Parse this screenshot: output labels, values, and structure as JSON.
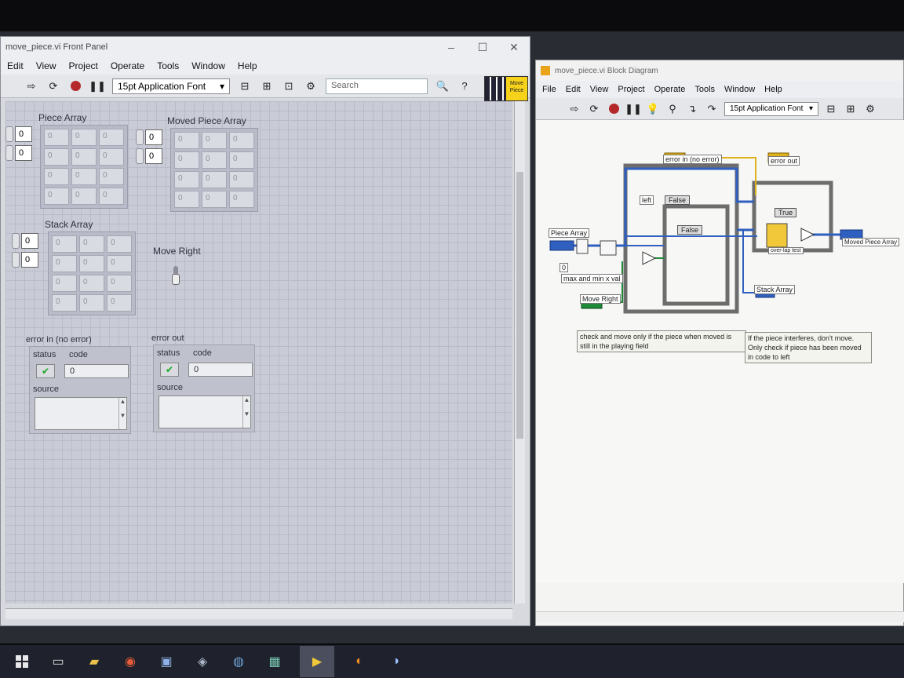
{
  "front_panel": {
    "title": "move_piece.vi Front Panel",
    "menu": [
      "Edit",
      "View",
      "Project",
      "Operate",
      "Tools",
      "Window",
      "Help"
    ],
    "font": "15pt Application Font",
    "search_placeholder": "Search",
    "vi_icon_text": "Move Piece",
    "piece_array": {
      "label": "Piece Array",
      "index": [
        "0",
        "0"
      ],
      "cells": [
        "0",
        "0",
        "0",
        "0",
        "0",
        "0",
        "0",
        "0",
        "0",
        "0",
        "0",
        "0"
      ]
    },
    "moved_piece_array": {
      "label": "Moved Piece Array",
      "index": [
        "0",
        "0"
      ],
      "cells": [
        "0",
        "0",
        "0",
        "0",
        "0",
        "0",
        "0",
        "0",
        "0",
        "0",
        "0",
        "0"
      ]
    },
    "stack_array": {
      "label": "Stack Array",
      "index": [
        "0",
        "0"
      ],
      "cells": [
        "0",
        "0",
        "0",
        "0",
        "0",
        "0",
        "0",
        "0",
        "0",
        "0",
        "0",
        "0"
      ]
    },
    "move_right": {
      "label": "Move Right"
    },
    "error_in": {
      "label": "error in (no error)",
      "status_label": "status",
      "code_label": "code",
      "code": "0",
      "source_label": "source"
    },
    "error_out": {
      "label": "error out",
      "status_label": "status",
      "code_label": "code",
      "code": "0",
      "source_label": "source"
    }
  },
  "block_diagram": {
    "title": "move_piece.vi Block Diagram",
    "menu": [
      "File",
      "Edit",
      "View",
      "Project",
      "Operate",
      "Tools",
      "Window",
      "Help"
    ],
    "font": "15pt Application Font",
    "labels": {
      "error_in": "error in (no error)",
      "error_out": "error out",
      "piece_array": "Piece Array",
      "moved_piece_array": "Moved Piece Array",
      "stack_array": "Stack Array",
      "move_right": "Move Right",
      "max_min": "max and min x val",
      "left": "left",
      "overlap": "over-lap test",
      "const_zero": "0"
    },
    "case_selectors": [
      "False",
      "False",
      "True"
    ],
    "comment_1": "check and move only if the piece when moved is still in the playing field",
    "comment_2": "If the piece interferes, don't move. Only check if piece has been moved in code to left"
  },
  "colors": {
    "wire_blue": "#2f5fbf",
    "wire_green": "#1f8a3a",
    "wire_yellow": "#e0b21c",
    "status_ok": "#17a821",
    "stop_red": "#b5282a"
  }
}
